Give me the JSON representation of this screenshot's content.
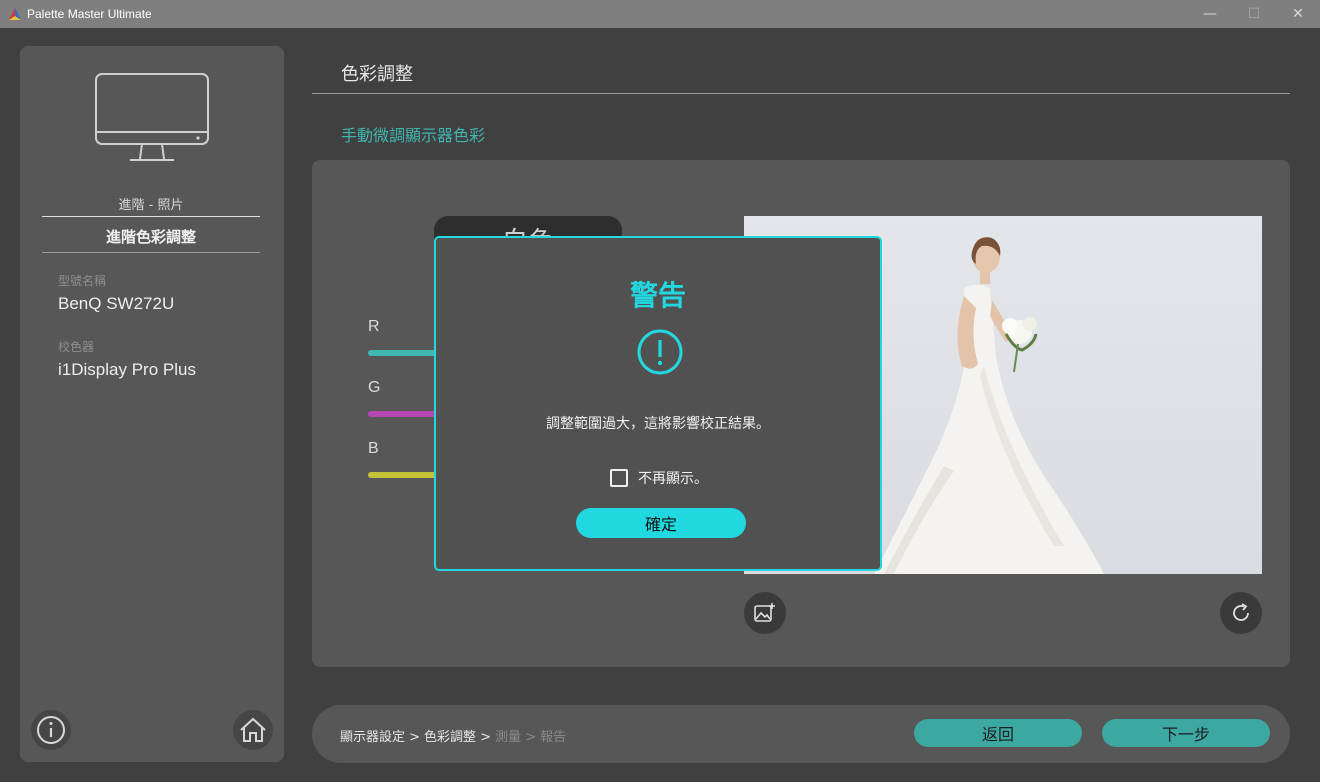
{
  "window": {
    "title": "Palette Master Ultimate",
    "minimize": "—",
    "maximize": "☐",
    "close": "✕"
  },
  "sidebar": {
    "profile_sub": "進階 - 照片",
    "profile_main": "進階色彩調整",
    "model_label": "型號名稱",
    "model_value": "BenQ SW272U",
    "calibrator_label": "校色器",
    "calibrator_value": "i1Display Pro Plus",
    "info_icon": "info-icon",
    "home_icon": "home-icon"
  },
  "main": {
    "page_title": "色彩調整",
    "section_title": "手動微調顯示器色彩",
    "tab_label": "白色",
    "channels": [
      {
        "label": "R",
        "color": "#3fb6b0"
      },
      {
        "label": "G",
        "color": "#b548b3"
      },
      {
        "label": "B",
        "color": "#c5c23a"
      }
    ]
  },
  "bottom": {
    "breadcrumb": [
      {
        "label": "顯示器設定 >",
        "active": true
      },
      {
        "label": "色彩調整 >",
        "active": true
      },
      {
        "label": "測量 >",
        "active": false
      },
      {
        "label": "報告",
        "active": false
      }
    ],
    "back_label": "返回",
    "next_label": "下一步"
  },
  "dialog": {
    "title": "警告",
    "message": "調整範圍過大，這將影響校正結果。",
    "checkbox_label": "不再顯示。",
    "checkbox_checked": false,
    "ok_label": "確定"
  },
  "colors": {
    "accent": "#22d8e0",
    "teal": "#3da7a2"
  }
}
